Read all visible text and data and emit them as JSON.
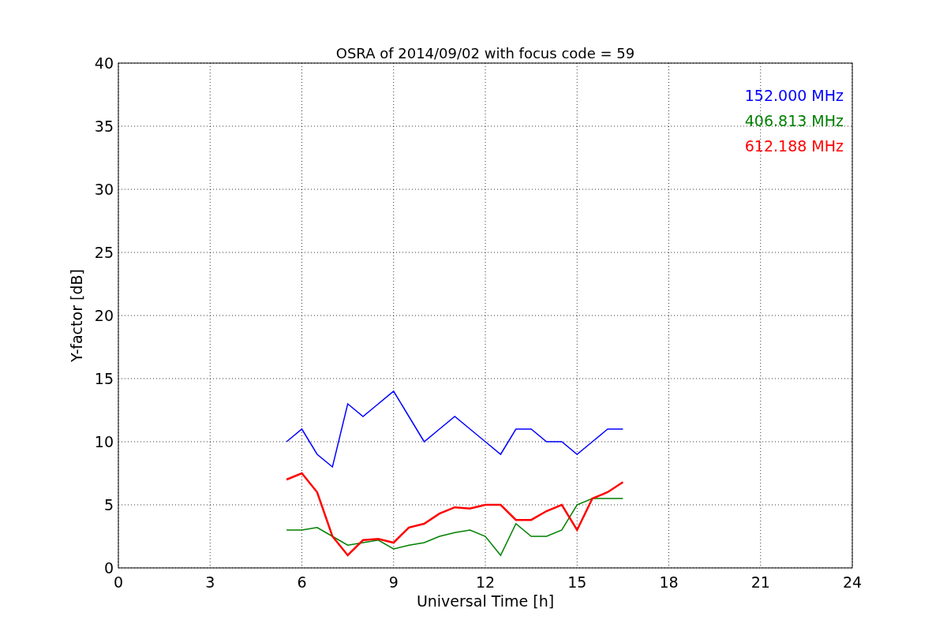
{
  "chart_data": {
    "type": "line",
    "title": "OSRA of 2014/09/02 with focus code = 59",
    "xlabel": "Universal Time [h]",
    "ylabel": "Y-factor [dB]",
    "x": [
      5.5,
      6,
      6.5,
      7,
      7.5,
      8,
      8.5,
      9,
      9.5,
      10,
      10.5,
      11,
      11.5,
      12,
      12.5,
      13,
      13.5,
      14,
      14.5,
      15,
      15.5,
      16,
      16.5
    ],
    "series": [
      {
        "name": "152.000 MHz",
        "color": "#0000ff",
        "values": [
          10,
          11,
          9,
          8,
          13,
          12,
          13,
          14,
          12,
          10,
          11,
          12,
          11,
          10,
          9,
          11,
          11,
          10,
          10,
          9,
          10,
          11,
          11
        ]
      },
      {
        "name": "406.813 MHz",
        "color": "#008000",
        "values": [
          3,
          3,
          3.2,
          2.5,
          1.8,
          2,
          2.2,
          1.5,
          1.8,
          2,
          2.5,
          2.8,
          3,
          2.5,
          1,
          3.5,
          2.5,
          2.5,
          3,
          5,
          5.5,
          5.5,
          5.5
        ]
      },
      {
        "name": "612.188 MHz",
        "color": "#ff0000",
        "values": [
          7,
          7.5,
          6,
          2.5,
          1,
          2.2,
          2.3,
          2,
          3.2,
          3.5,
          4.3,
          4.8,
          4.7,
          5,
          5,
          3.8,
          3.8,
          4.5,
          5,
          3,
          5.5,
          6,
          6.8
        ]
      }
    ],
    "xlim": [
      0,
      24
    ],
    "ylim": [
      0,
      40
    ],
    "xticks": [
      0,
      3,
      6,
      9,
      12,
      15,
      18,
      21,
      24
    ],
    "yticks": [
      0,
      5,
      10,
      15,
      20,
      25,
      30,
      35,
      40
    ],
    "grid": true
  }
}
